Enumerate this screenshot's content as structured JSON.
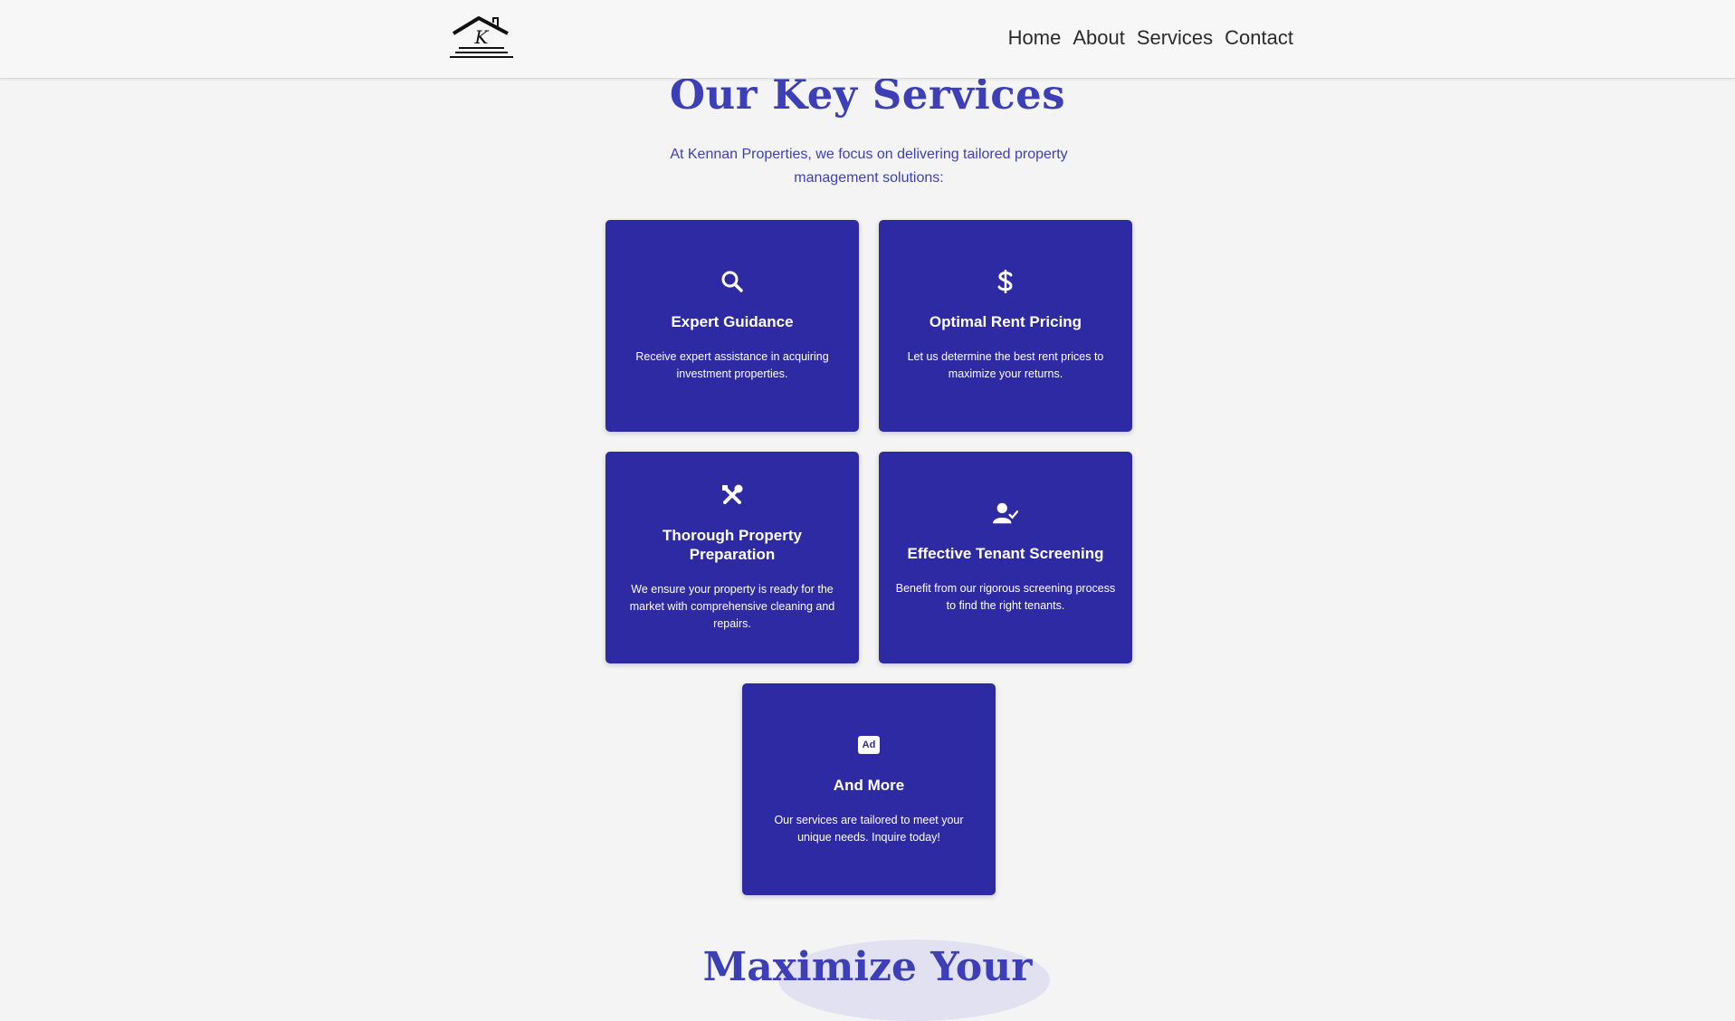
{
  "header": {
    "logo_letter": "K",
    "nav": [
      "Home",
      "About",
      "Services",
      "Contact"
    ]
  },
  "services": {
    "title": "Our Key Services",
    "intro": "At Kennan Properties, we focus on delivering tailored property management solutions:",
    "cards": [
      {
        "icon": "search-icon",
        "title": "Expert Guidance",
        "text": "Receive expert assistance in acquiring investment properties."
      },
      {
        "icon": "dollar-icon",
        "title": "Optimal Rent Pricing",
        "text": "Let us determine the best rent prices to maximize your returns."
      },
      {
        "icon": "tools-icon",
        "title": "Thorough Property Preparation",
        "text": "We ensure your property is ready for the market with comprehensive cleaning and repairs."
      },
      {
        "icon": "user-check-icon",
        "title": "Effective Tenant Screening",
        "text": "Benefit from our rigorous screening process to find the right tenants."
      },
      {
        "icon": "ad-icon",
        "title": "And More",
        "text": "Our services are tailored to meet your unique needs. Inquire today!"
      }
    ],
    "ad_badge": "Ad"
  },
  "next_section": {
    "title_partial": "Maximize Your"
  },
  "colors": {
    "accent": "#3d3fb6",
    "card_bg": "#2e2aa3",
    "page_bg": "#f4f4f4"
  }
}
